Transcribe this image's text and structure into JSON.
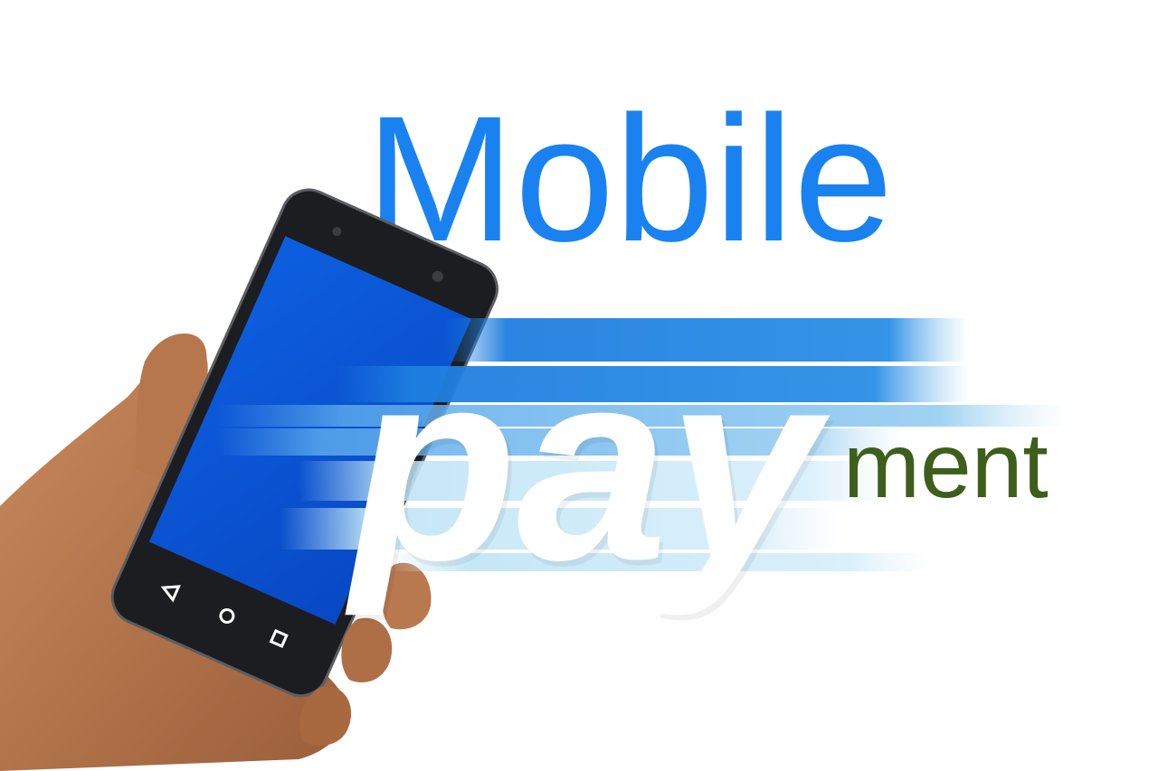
{
  "headline": {
    "line1": "Mobile",
    "line2": "pay",
    "line3": "ment"
  },
  "colors": {
    "background": "#ffffff",
    "mobile_text": "#1a82f0",
    "pay_text": "#ffffff",
    "ment_text": "#3e5e1c",
    "speed_stripe_dark": "#1f7fe0",
    "speed_stripe_light": "#bfe4f6",
    "phone_screen": "#0a55d6",
    "phone_body": "#1c1d20",
    "skin": "#b8784f"
  },
  "icons": {
    "nav_back": "triangle-back-icon",
    "nav_home": "circle-home-icon",
    "nav_recent": "square-recent-icon"
  }
}
